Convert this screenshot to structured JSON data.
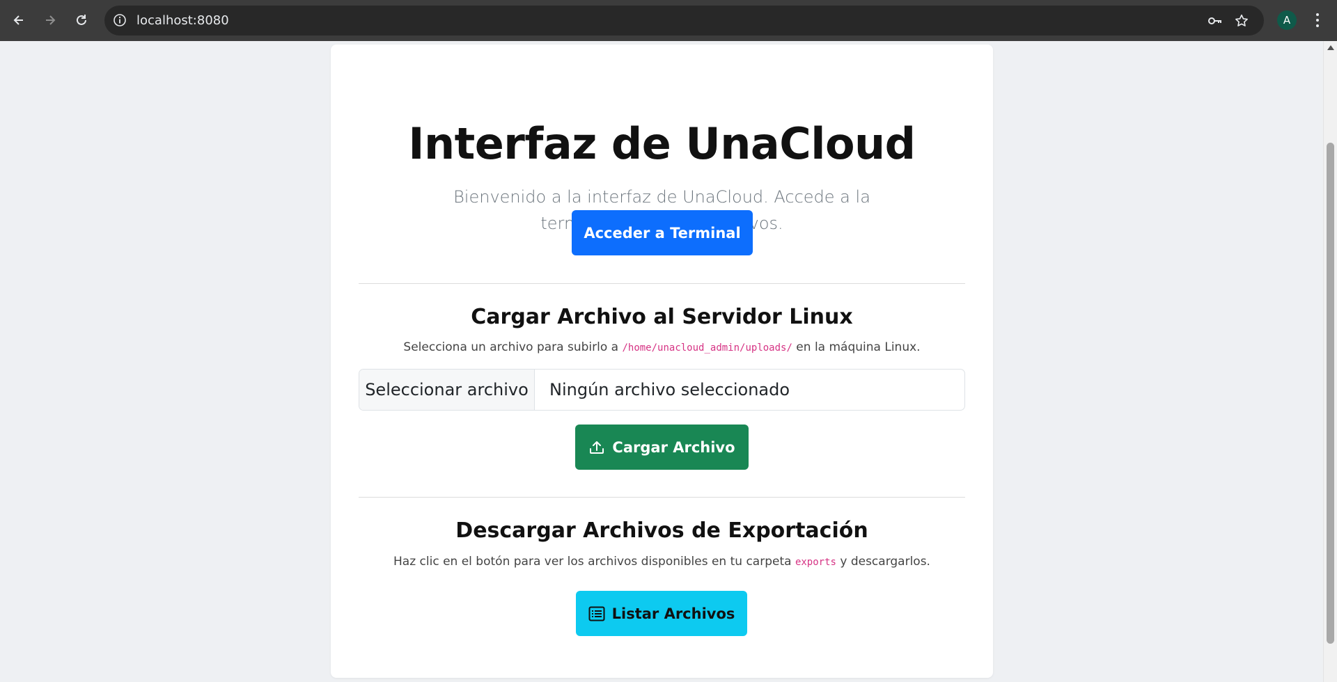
{
  "browser": {
    "url": "localhost:8080",
    "avatar_letter": "A",
    "icons": [
      "back-icon",
      "forward-icon",
      "reload-icon",
      "info-icon",
      "key-icon",
      "star-icon",
      "menu-icon"
    ]
  },
  "page": {
    "title": "Interfaz de UnaCloud",
    "lead": "Bienvenido a la interfaz de UnaCloud. Accede a la terminal o gestiona archivos.",
    "terminal_button": "Acceder a Terminal",
    "upload": {
      "heading": "Cargar Archivo al Servidor Linux",
      "desc_before": "Selecciona un archivo para subirlo a ",
      "path": "/home/unacloud_admin/uploads/",
      "desc_after": " en la máquina Linux.",
      "choose_label": "Seleccionar archivo",
      "no_file_label": "Ningún archivo seleccionado",
      "button": "Cargar Archivo"
    },
    "download": {
      "heading": "Descargar Archivos de Exportación",
      "desc_before": "Haz clic en el botón para ver los archivos disponibles en tu carpeta ",
      "folder": "exports",
      "desc_after": " y descargarlos.",
      "button": "Listar Archivos"
    }
  },
  "colors": {
    "primary": "#0d6efd",
    "success": "#198754",
    "info": "#0dcaf0",
    "code": "#d63384",
    "background": "#eef0f3"
  }
}
